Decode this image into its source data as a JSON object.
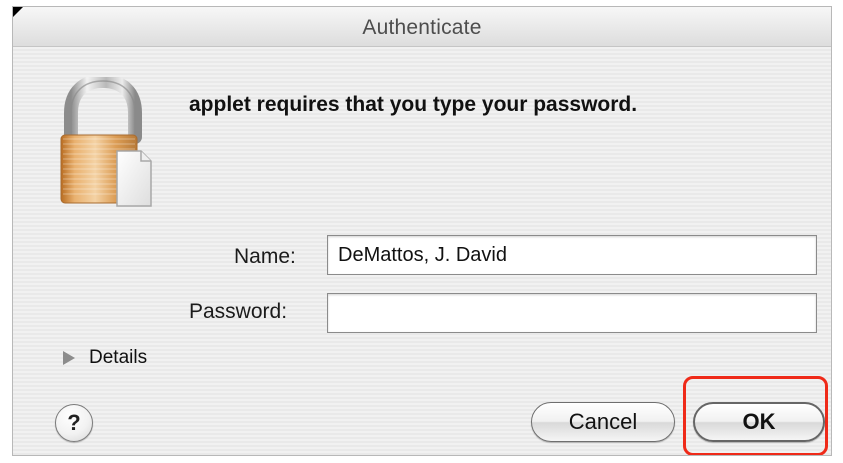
{
  "dialog": {
    "title": "Authenticate",
    "message": "applet requires that you type your password."
  },
  "form": {
    "name_label": "Name:",
    "name_value": "DeMattos, J. David",
    "password_label": "Password:",
    "password_value": ""
  },
  "details": {
    "label": "Details"
  },
  "buttons": {
    "help": "?",
    "cancel": "Cancel",
    "ok": "OK"
  },
  "icons": {
    "lock": "lock-icon",
    "document": "document-icon",
    "disclosure": "disclosure-triangle-icon",
    "help": "help-icon"
  },
  "colors": {
    "highlight": "#ef2a19",
    "lock_body": "#d99a4d",
    "shackle": "#bdbdbd"
  }
}
